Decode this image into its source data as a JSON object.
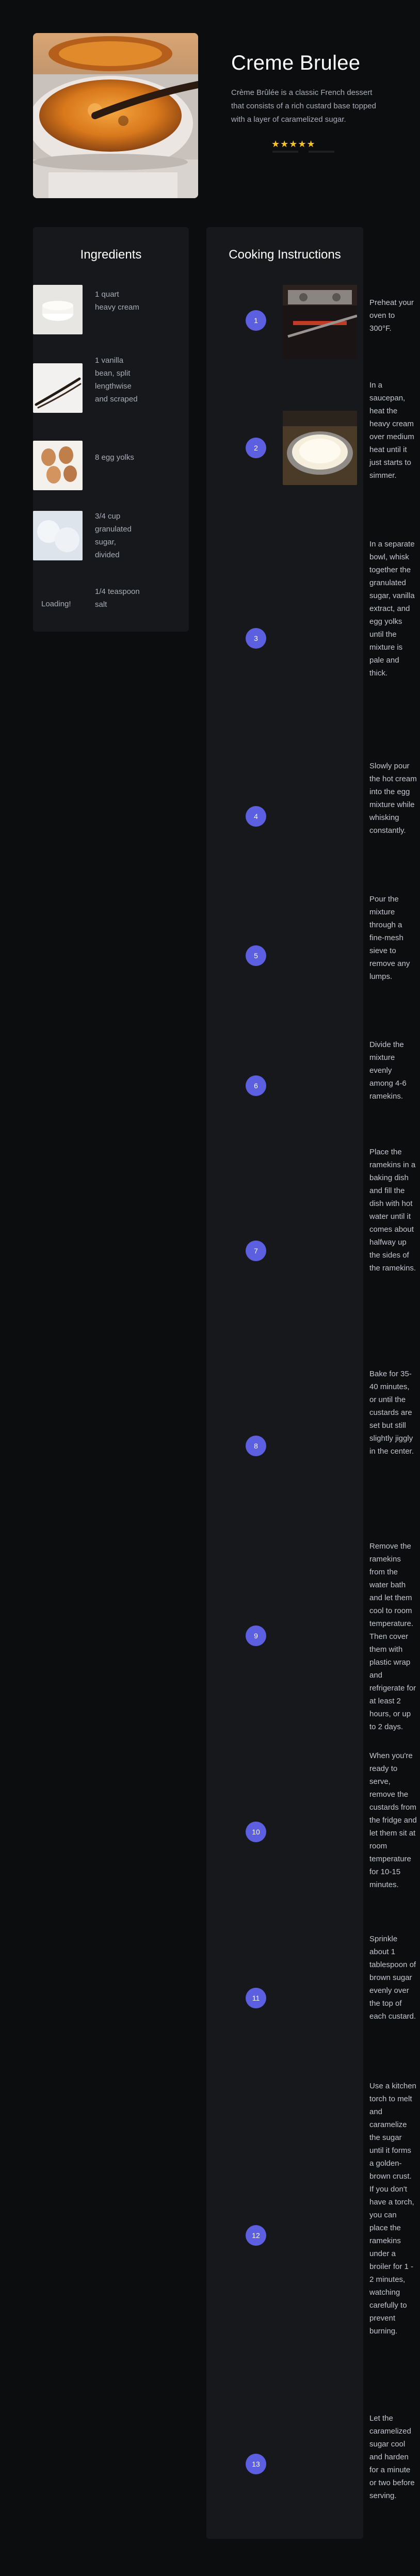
{
  "recipe": {
    "title": "Creme Brulee",
    "description": "Crème Brûlée is a classic French dessert that consists of a rich custard base topped with a layer of caramelized sugar.",
    "rating_stars": "★★★★★",
    "rating_value": 5
  },
  "ingredients": {
    "title": "Ingredients",
    "items": [
      {
        "text": "1 quart heavy cream",
        "icon": "cream-image"
      },
      {
        "text": "1 vanilla bean, split lengthwise and scraped",
        "icon": "vanilla-bean-image"
      },
      {
        "text": "8 egg yolks",
        "icon": "egg-yolks-image"
      },
      {
        "text": "3/4 cup granulated sugar, divided",
        "icon": "sugar-image"
      },
      {
        "text": "1/4 teaspoon salt",
        "icon": "salt-image"
      }
    ],
    "loading": "Loading!"
  },
  "instructions": {
    "title": "Cooking Instructions",
    "steps": [
      {
        "number": "1",
        "text": "Preheat your oven to 300°F."
      },
      {
        "number": "2",
        "text": "In a saucepan, heat the heavy cream over medium heat until it just starts to simmer."
      },
      {
        "number": "3",
        "text": "In a separate bowl, whisk together the granulated sugar, vanilla extract, and egg yolks until the mixture is pale and thick."
      },
      {
        "number": "4",
        "text": "Slowly pour the hot cream into the egg mixture while whisking constantly."
      },
      {
        "number": "5",
        "text": "Pour the mixture through a fine-mesh sieve to remove any lumps."
      },
      {
        "number": "6",
        "text": "Divide the mixture evenly among 4-6 ramekins."
      },
      {
        "number": "7",
        "text": "Place the ramekins in a baking dish and fill the dish with hot water until it comes about halfway up the sides of the ramekins."
      },
      {
        "number": "8",
        "text": "Bake for 35-40 minutes, or until the custards are set but still slightly jiggly in the center."
      },
      {
        "number": "9",
        "text": "Remove the ramekins from the water bath and let them cool to room temperature. Then cover them with plastic wrap and refrigerate for at least 2 hours, or up to 2 days."
      },
      {
        "number": "10",
        "text": "When you're ready to serve, remove the custards from the fridge and let them sit at room temperature for 10-15 minutes."
      },
      {
        "number": "11",
        "text": "Sprinkle about 1 tablespoon of brown sugar evenly over the top of each custard."
      },
      {
        "number": "12",
        "text": "Use a kitchen torch to melt and caramelize the sugar until it forms a golden-brown crust. If you don't have a torch, you can place the ramekins under a broiler for 1 - 2 minutes, watching carefully to prevent burning."
      },
      {
        "number": "13",
        "text": "Let the caramelized sugar cool and harden for a minute or two before serving."
      }
    ]
  },
  "colors": {
    "background": "#0c0d0f",
    "panel": "#16181c",
    "accent": "#5b5fe0",
    "star": "#f5c518"
  }
}
